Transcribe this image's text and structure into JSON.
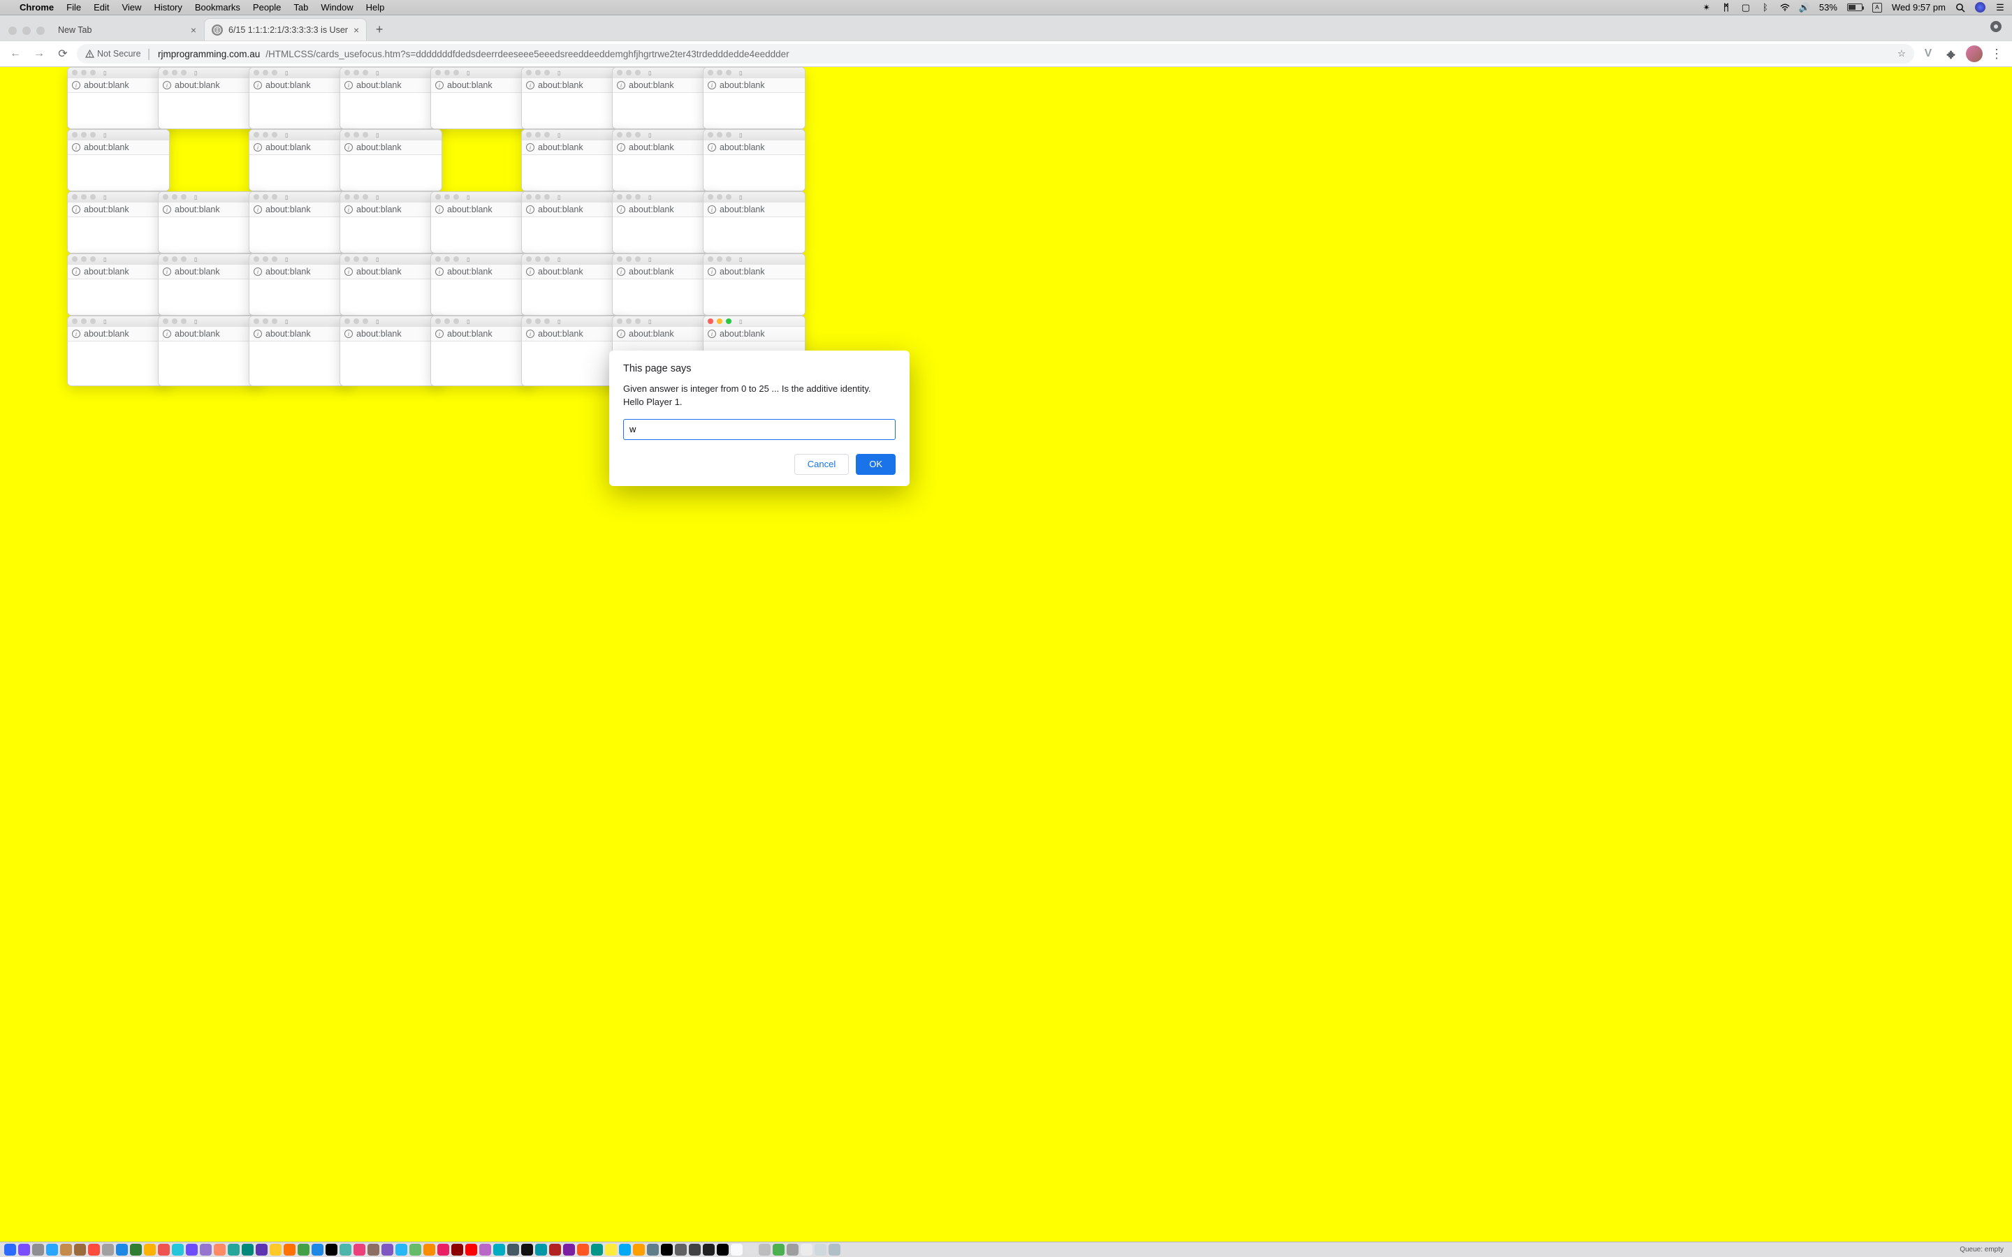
{
  "menubar": {
    "app": "Chrome",
    "items": [
      "File",
      "Edit",
      "View",
      "History",
      "Bookmarks",
      "People",
      "Tab",
      "Window",
      "Help"
    ],
    "battery": "53%",
    "clock": "Wed 9:57 pm"
  },
  "tabs": {
    "t0": {
      "title": "New Tab"
    },
    "t1": {
      "title": "6/15 1:1:1:2:1/3:3:3:3:3 is User"
    }
  },
  "omni": {
    "warn": "Not Secure",
    "host": "rjmprogramming.com.au",
    "rest": "/HTMLCSS/cards_usefocus.htm?s=dddddddfdedsdeerrdeeseee5eeedsreeddeeddemghfjhgrtrwe2ter43trdedddedde4eeddder"
  },
  "mini_addr": "about:blank",
  "mini_positions": {
    "yStep": 89,
    "xStep": 130,
    "bodyH_short": 51,
    "bodyH_long": 63,
    "row2_missing": [
      1,
      4
    ],
    "row5_count": 7,
    "active_index_row5": 7
  },
  "dialog": {
    "title": "This page says",
    "msg1": "Given answer is integer from 0 to 25 ... Is the additive identity.",
    "msg2": "Hello Player 1.",
    "input": "w",
    "cancel": "Cancel",
    "ok": "OK"
  },
  "dock": {
    "queue": "Queue: empty",
    "apps": [
      "#2b6cff",
      "#7a4dff",
      "#8e8e93",
      "#2aa6ff",
      "#c58b4a",
      "#9b6b3c",
      "#ff4b3e",
      "#a0a0a0",
      "#1e88e5",
      "#2e7d32",
      "#ffb300",
      "#ef5350",
      "#26c6da",
      "#6d4cfa",
      "#9575cd",
      "#ff8a65",
      "#26a69a",
      "#00897b",
      "#5e35b1",
      "#ffca28",
      "#ff7200",
      "#43a047",
      "#1e88e5",
      "#000000",
      "#4db6ac",
      "#ec407a",
      "#8d6e63",
      "#7e57c2",
      "#29b6f6",
      "#66bb6a",
      "#fb8c00",
      "#e91e63",
      "#8b0000",
      "#ff0000",
      "#ba68c8",
      "#00acc1",
      "#455a64",
      "#111111",
      "#0097a7",
      "#b22222",
      "#7b1fa2",
      "#ff5722",
      "#009688",
      "#ffeb3b",
      "#03a9f4",
      "#ffa000",
      "#607d8b",
      "#000000",
      "#616161",
      "#424242",
      "#212121",
      "#000000",
      "#fafafa",
      "#e0e0e0",
      "#bdbdbd",
      "#4caf50",
      "#9e9e9e",
      "#ececec",
      "#cfd8dc",
      "#b0bec5"
    ]
  }
}
